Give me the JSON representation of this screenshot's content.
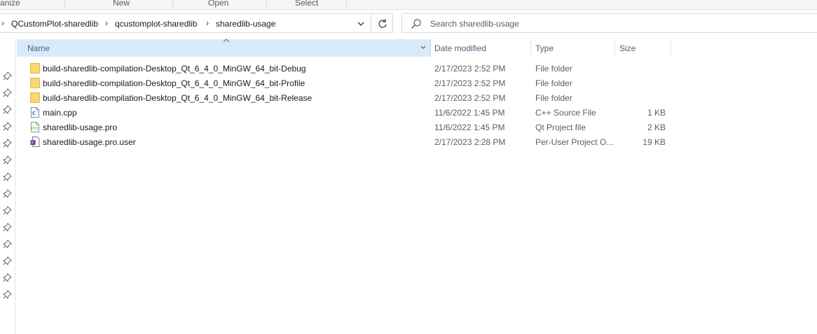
{
  "ribbon": {
    "groups": [
      "anize",
      "New",
      "Open",
      "Select"
    ]
  },
  "address": {
    "crumbs": [
      "QCustomPlot-sharedlib",
      "qcustomplot-sharedlib",
      "sharedlib-usage"
    ],
    "lead_chevron": "›",
    "chevron": "›"
  },
  "search": {
    "placeholder": "Search sharedlib-usage"
  },
  "columns": {
    "name": "Name",
    "date": "Date modified",
    "type": "Type",
    "size": "Size"
  },
  "files": [
    {
      "name": "build-sharedlib-compilation-Desktop_Qt_6_4_0_MinGW_64_bit-Debug",
      "date": "2/17/2023 2:52 PM",
      "type": "File folder",
      "size": "",
      "icon": "folder-icon"
    },
    {
      "name": "build-sharedlib-compilation-Desktop_Qt_6_4_0_MinGW_64_bit-Profile",
      "date": "2/17/2023 2:52 PM",
      "type": "File folder",
      "size": "",
      "icon": "folder-icon"
    },
    {
      "name": "build-sharedlib-compilation-Desktop_Qt_6_4_0_MinGW_64_bit-Release",
      "date": "2/17/2023 2:52 PM",
      "type": "File folder",
      "size": "",
      "icon": "folder-icon"
    },
    {
      "name": "main.cpp",
      "date": "11/6/2022 1:45 PM",
      "type": "C++ Source File",
      "size": "1 KB",
      "icon": "cpp-file-icon"
    },
    {
      "name": "sharedlib-usage.pro",
      "date": "11/6/2022 1:45 PM",
      "type": "Qt Project file",
      "size": "2 KB",
      "icon": "qt-project-file-icon"
    },
    {
      "name": "sharedlib-usage.pro.user",
      "date": "2/17/2023 2:28 PM",
      "type": "Per-User Project O...",
      "size": "19 KB",
      "icon": "user-project-file-icon"
    }
  ],
  "colors": {
    "header_selected": "#d9ebf9",
    "folder": "#f8d775"
  }
}
